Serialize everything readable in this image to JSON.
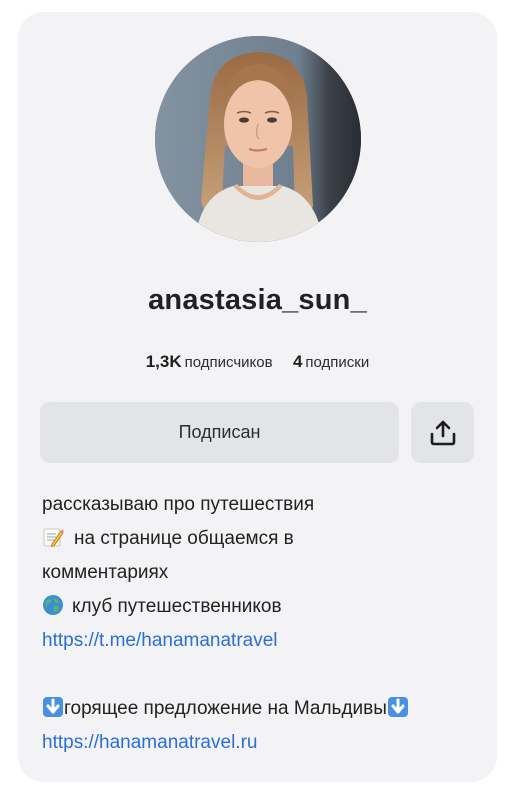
{
  "profile": {
    "username": "anastasia_sun_",
    "followers_count": "1,3K",
    "followers_label": "подписчиков",
    "following_count": "4",
    "following_label": "подписки"
  },
  "actions": {
    "subscribe_label": "Подписан",
    "share_icon": "share-icon"
  },
  "bio": {
    "line1": "рассказываю про путешествия",
    "line2_emoji": "memo-icon",
    "line2": "на странице общаемся в",
    "line3": "комментариях",
    "line4_emoji": "globe-icon",
    "line4": "клуб путешественников",
    "link1": "https://t.me/hanamanatravel",
    "offer_emoji": "down-arrow-icon",
    "offer": "горящее предложение на Мальдивы",
    "link2": "https://hanamanatravel.ru"
  },
  "colors": {
    "card_bg": "#f3f3f5",
    "button_bg": "#e3e4e8",
    "link": "#2a6fd6",
    "text": "#222222"
  }
}
